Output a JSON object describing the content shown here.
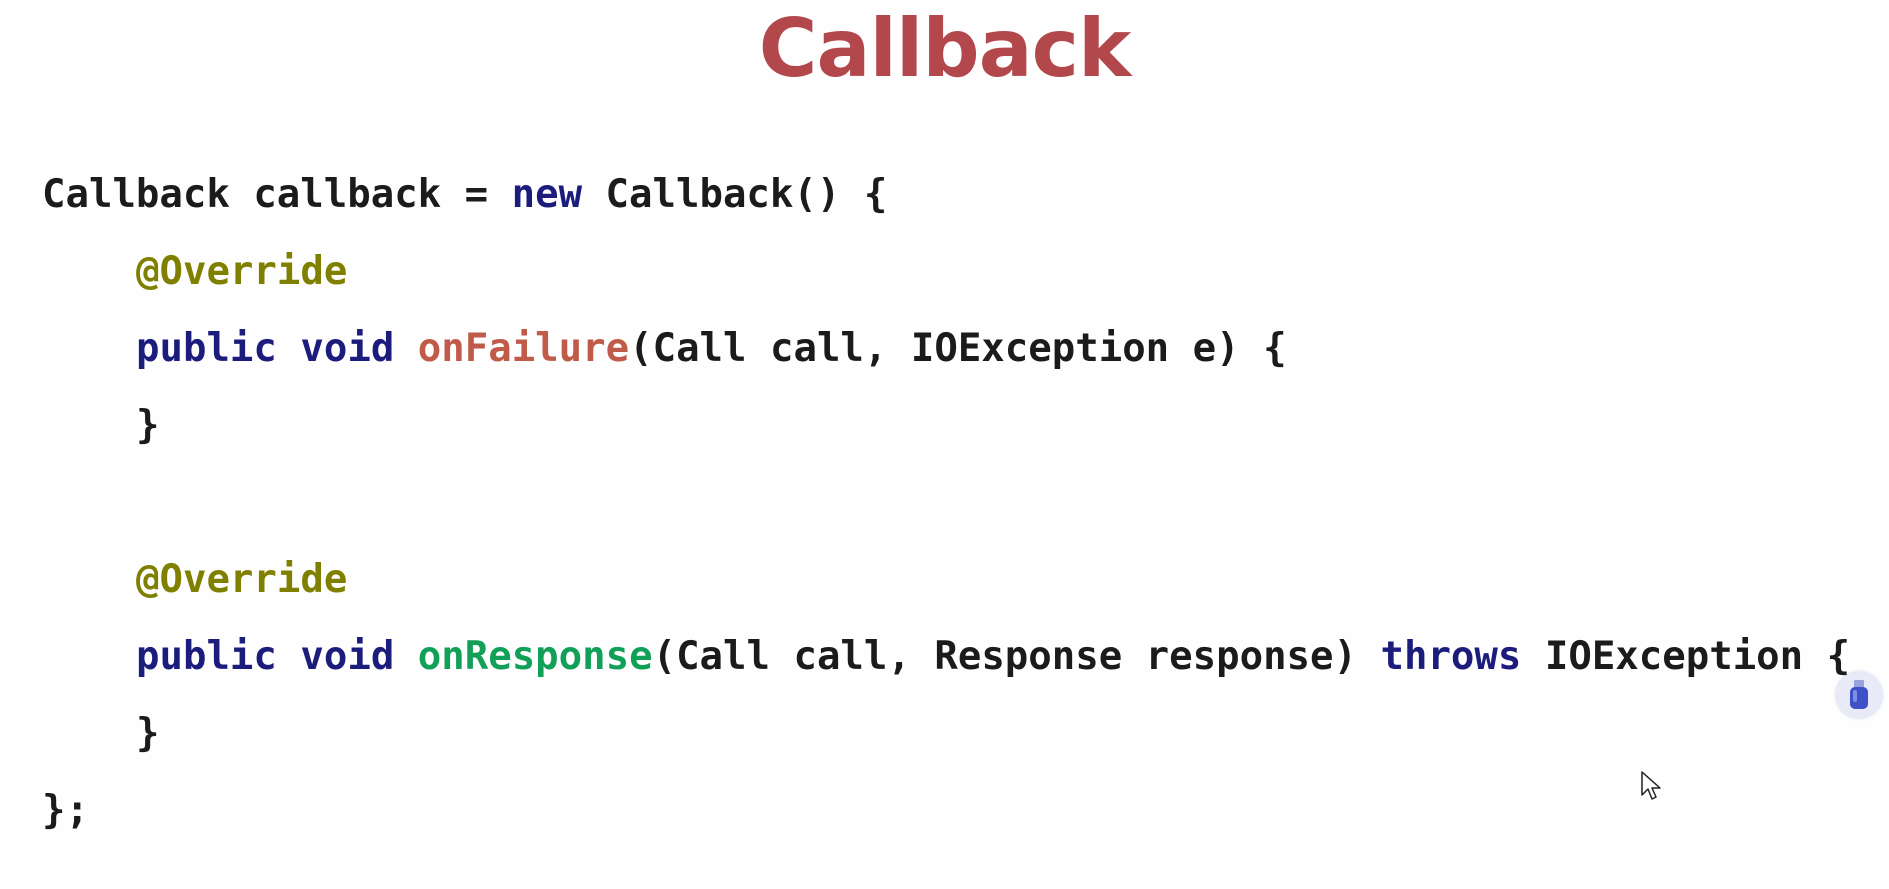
{
  "slide": {
    "title": "Callback"
  },
  "code": {
    "line1": {
      "a": "Callback callback = ",
      "kw_new": "new",
      "b": " Callback() {"
    },
    "line2": {
      "annotation": "@Override"
    },
    "line3": {
      "kw_public": "public",
      "kw_void": "void",
      "method": "onFailure",
      "rest": "(Call call, IOException e) {"
    },
    "line4": {
      "brace": "}"
    },
    "line5": {
      "annotation": "@Override"
    },
    "line6": {
      "kw_public": "public",
      "kw_void": "void",
      "method": "onResponse",
      "mid": "(Call call, Response response) ",
      "kw_throws": "throws",
      "rest": " IOException {"
    },
    "line7": {
      "brace": "}"
    },
    "line8": {
      "end": "};"
    }
  },
  "icons": {
    "pen": "usb-pen-icon",
    "cursor": "mouse-cursor-icon"
  },
  "colors": {
    "title": "#b3484c",
    "keyword": "#1c1c7c",
    "annotation": "#808000",
    "method_failure": "#c05b4a",
    "method_response": "#10a058",
    "text": "#1b1b1b"
  }
}
